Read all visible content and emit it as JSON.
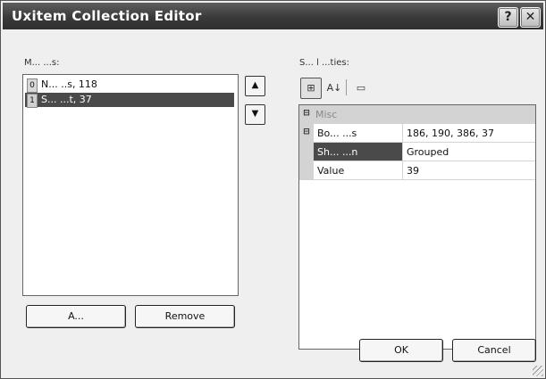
{
  "window": {
    "title": "Uxitem Collection Editor",
    "help_glyph": "?",
    "close_glyph": "✕"
  },
  "members": {
    "label": "M... ...s:",
    "items": [
      {
        "index": "0",
        "text": "N... ..s, 118"
      },
      {
        "index": "1",
        "text": "S... ...t, 37"
      }
    ],
    "selected_index": 1
  },
  "order_buttons": {
    "up": "▲",
    "down": "▼"
  },
  "list_buttons": {
    "add": "A...",
    "remove": "Remove"
  },
  "properties": {
    "label": "S...   l           ...ties:",
    "toolbar": {
      "categorized": "⊞",
      "alphabetical": "A↓",
      "pages": "▭"
    },
    "category": "Misc",
    "rows": [
      {
        "name": "Bo... ...s",
        "value": "186, 190, 386, 37",
        "expander": "⊟",
        "selected": false
      },
      {
        "name": "Sh... ...n",
        "value": "Grouped",
        "expander": "",
        "selected": true
      },
      {
        "name": "Value",
        "value": "39",
        "expander": "",
        "selected": false
      }
    ]
  },
  "footer": {
    "ok": "OK",
    "cancel": "Cancel"
  }
}
